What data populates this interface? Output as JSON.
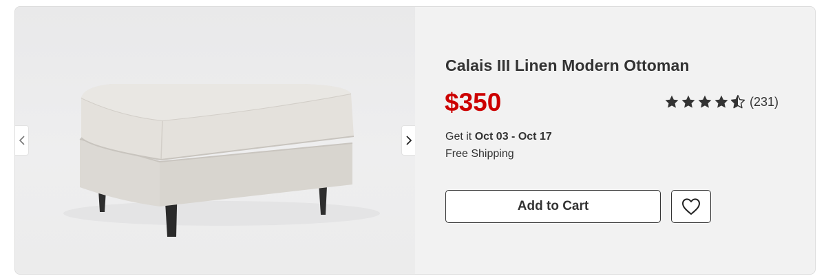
{
  "product": {
    "title": "Calais III Linen Modern Ottoman",
    "price": "$350",
    "rating": {
      "value": 4.5,
      "max": 5,
      "count_label": "(231)"
    },
    "delivery": {
      "prefix": "Get it ",
      "dates": "Oct 03 - Oct 17"
    },
    "shipping": "Free Shipping"
  },
  "gallery": {
    "prev_icon": "chevron-left-icon",
    "next_icon": "chevron-right-icon"
  },
  "actions": {
    "add_to_cart_label": "Add to Cart",
    "favorite_icon": "heart-icon"
  },
  "colors": {
    "price": "#cc0000",
    "text": "#333333",
    "panel_background": "#f2f2f2"
  }
}
